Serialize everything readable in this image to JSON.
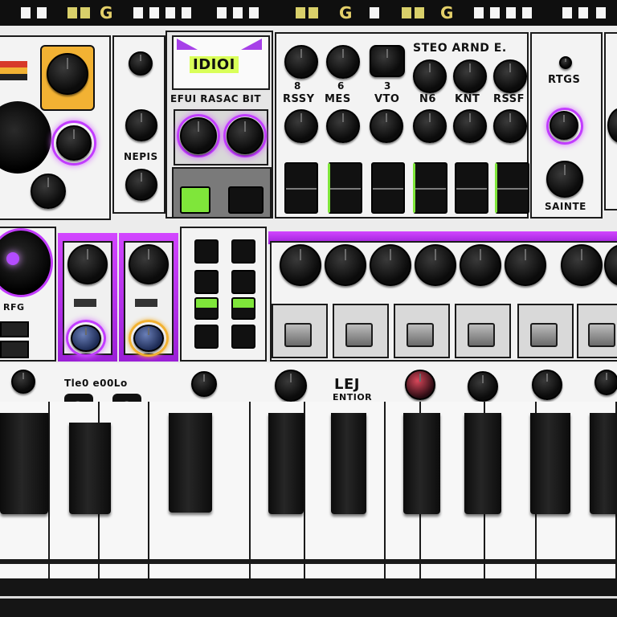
{
  "top_strip_label": "G",
  "lcd": {
    "text": "IDIOI",
    "caption": "EFUI RASAC BIT"
  },
  "labels": {
    "header_right": "STEO ARND E.",
    "row_labels": [
      "RSSY",
      "MES",
      "VTO",
      "N6",
      "KNT",
      "RSSF"
    ],
    "row_nums": [
      "8",
      "6",
      "3"
    ],
    "left_mid": "NEPIS",
    "right_top": "RTGS",
    "right_mid": "SAINTE",
    "left_bottom": "RFG",
    "keys_left": "Tle0  e00Lo",
    "center_logo": "LEJ",
    "center_logo_sub": "ENTIOR",
    "digits": [
      "3",
      "8"
    ]
  },
  "colors": {
    "accent_magenta": "#c23cff",
    "accent_green": "#7fe63a",
    "accent_yellow": "#f2b233",
    "panel": "#f3f3f3",
    "ink": "#111111"
  },
  "icons": {
    "pads": "square-pad-icon",
    "knobs": "rotary-knob-icon",
    "faders": "slider-fader-icon",
    "keys": "piano-key-icon"
  }
}
